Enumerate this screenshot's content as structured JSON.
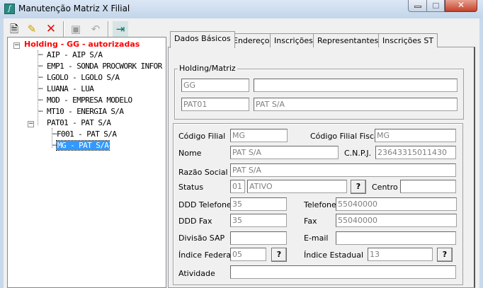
{
  "window": {
    "title": "Manutenção Matriz X Filial"
  },
  "icons": {
    "app": "app-icon",
    "new": "new-document-icon",
    "edit": "edit-icon",
    "delete": "delete-x-icon",
    "save": "save-disk-icon",
    "undo": "undo-icon",
    "exit": "exit-door-icon"
  },
  "tree": {
    "root": "Holding -  GG -  autorizadas",
    "items": [
      "AIP - AIP S/A",
      "EMP1 - SONDA PROCWORK INFOR",
      "LGOLO - LGOLO S/A",
      "LUANA - LUA",
      "MOD - EMPRESA MODELO",
      "MT10 - ENERGIA S/A",
      "PAT01 - PAT S/A"
    ],
    "children": [
      "F001 - PAT S/A",
      "MG - PAT S/A"
    ],
    "selected": "MG - PAT S/A"
  },
  "tabs": [
    "Dados Básicos",
    "Endereço",
    "Inscrições",
    "Representantes",
    "Inscrições ST"
  ],
  "holding": {
    "label": "Holding/Matriz",
    "code1": "GG",
    "name1": "",
    "code2": "PAT01",
    "name2": "PAT S/A"
  },
  "form": {
    "codigo_filial": {
      "label": "Código Filial",
      "value": "MG"
    },
    "codigo_filial_fiscal": {
      "label": "Código Filial Fiscal",
      "value": "MG"
    },
    "nome": {
      "label": "Nome",
      "value": "PAT S/A"
    },
    "cnpj": {
      "label": "C.N.P.J.",
      "value": "23643315011430"
    },
    "razao_social": {
      "label": "Razão Social",
      "value": "PAT S/A"
    },
    "status": {
      "label": "Status",
      "code": "01",
      "value": "ATIVO"
    },
    "centro": {
      "label": "Centro",
      "value": ""
    },
    "ddd_telefone": {
      "label": "DDD Telefone",
      "value": "35"
    },
    "telefone": {
      "label": "Telefone",
      "value": "55040000"
    },
    "ddd_fax": {
      "label": "DDD Fax",
      "value": "35"
    },
    "fax": {
      "label": "Fax",
      "value": "55040000"
    },
    "divisao_sap": {
      "label": "Divisão SAP",
      "value": ""
    },
    "email": {
      "label": "E-mail",
      "value": ""
    },
    "indice_federal": {
      "label": "Índice Federal",
      "value": "05"
    },
    "indice_estadual": {
      "label": "Índice Estadual",
      "value": "13"
    },
    "atividade": {
      "label": "Atividade",
      "value": ""
    },
    "lookup_label": "?"
  }
}
